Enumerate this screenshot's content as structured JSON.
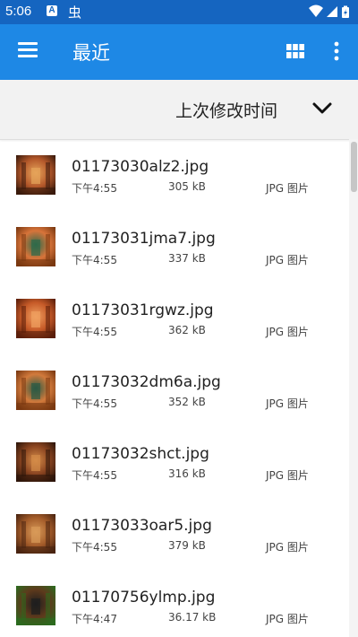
{
  "status_bar": {
    "time": "5:06",
    "notif_a": "A",
    "notif_bug": "虫"
  },
  "app_bar": {
    "title": "最近"
  },
  "sort": {
    "label": "上次修改时间"
  },
  "files": [
    {
      "name": "01173030alz2.jpg",
      "time": "下午4:55",
      "size": "305 kB",
      "type": "JPG 图片",
      "palette": [
        "#3a1a0c",
        "#b4582a",
        "#e6a45a"
      ]
    },
    {
      "name": "01173031jma7.jpg",
      "time": "下午4:55",
      "size": "337 kB",
      "type": "JPG 图片",
      "palette": [
        "#7a3810",
        "#d8743a",
        "#2e6a4a"
      ]
    },
    {
      "name": "01173031rgwz.jpg",
      "time": "下午4:55",
      "size": "362 kB",
      "type": "JPG 图片",
      "palette": [
        "#5a1e0a",
        "#c65a28",
        "#f0a060"
      ]
    },
    {
      "name": "01173032dm6a.jpg",
      "time": "下午4:55",
      "size": "352 kB",
      "type": "JPG 图片",
      "palette": [
        "#7a3810",
        "#d27a3c",
        "#2c5a44"
      ]
    },
    {
      "name": "01173032shct.jpg",
      "time": "下午4:55",
      "size": "316 kB",
      "type": "JPG 图片",
      "palette": [
        "#2e160a",
        "#8a4420",
        "#d48c48"
      ]
    },
    {
      "name": "01173033oar5.jpg",
      "time": "下午4:55",
      "size": "379 kB",
      "type": "JPG 图片",
      "palette": [
        "#4a2410",
        "#a45c2a",
        "#d89a58"
      ]
    },
    {
      "name": "01170756ylmp.jpg",
      "time": "下午4:47",
      "size": "36.17 kB",
      "type": "JPG 图片",
      "palette": [
        "#2c6a1e",
        "#5e3a1c",
        "#1e1e1e"
      ]
    }
  ]
}
